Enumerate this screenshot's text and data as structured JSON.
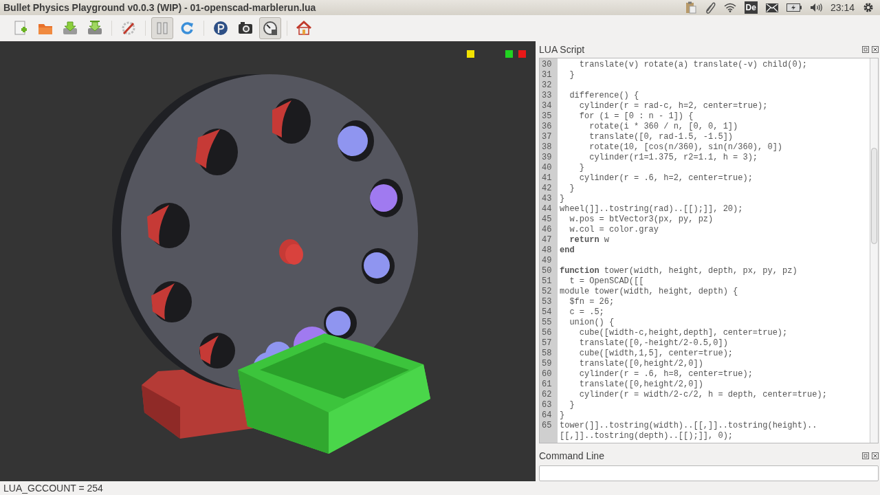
{
  "window": {
    "title": "Bullet Physics Playground v0.0.3 (WIP) - 01-openscad-marblerun.lua"
  },
  "tray": {
    "keyboard": "De",
    "time": "23:14"
  },
  "toolbar": [
    {
      "pressed": false
    },
    {
      "pressed": false
    },
    {
      "pressed": false
    },
    {
      "pressed": false
    },
    {
      "pressed": false
    },
    {
      "pressed": true
    },
    {
      "pressed": false
    },
    {
      "pressed": false
    },
    {
      "pressed": false
    },
    {
      "pressed": true
    },
    {
      "pressed": false
    }
  ],
  "script_panel": {
    "title": "LUA Script",
    "lines": [
      {
        "number": "30",
        "text": "    translate(v) rotate(a) translate(-v) child(0);"
      },
      {
        "number": "31",
        "text": "  }"
      },
      {
        "number": "32"
      },
      {
        "number": "33",
        "text": "  difference() {"
      },
      {
        "number": "34",
        "text": "    cylinder(r = rad-c, h=2, center=true);"
      },
      {
        "number": "35",
        "text": "    for (i = [0 : n - 1]) {"
      },
      {
        "number": "36",
        "text": "      rotate(i * 360 / n, [0, 0, 1])"
      },
      {
        "number": "37",
        "text": "      translate([0, rad-1.5, -1.5])"
      },
      {
        "number": "38",
        "text": "      rotate(10, [cos(n/360), sin(n/360), 0])"
      },
      {
        "number": "39",
        "text": "      cylinder(r1=1.375, r2=1.1, h = 3);"
      },
      {
        "number": "40",
        "text": "    }"
      },
      {
        "number": "41",
        "text": "    cylinder(r = .6, h=2, center=true);"
      },
      {
        "number": "42",
        "text": "  }"
      },
      {
        "number": "43",
        "text": "}"
      },
      {
        "number": "44",
        "text": "wheel(]]..tostring(rad)..[[);]], 20);"
      },
      {
        "number": "45",
        "text": "  w.pos = btVector3(px, py, pz)"
      },
      {
        "number": "46",
        "text": "  w.col = color.gray"
      },
      {
        "number": "47",
        "text": "  **return** w"
      },
      {
        "number": "48",
        "text": "**end**"
      },
      {
        "number": "49"
      },
      {
        "number": "50",
        "text": "**function** tower(width, height, depth, px, py, pz)"
      },
      {
        "number": "51",
        "text": "  t = OpenSCAD([["
      },
      {
        "number": "52",
        "text": "module tower(width, height, depth) {"
      },
      {
        "number": "53",
        "text": "  $fn = 26;"
      },
      {
        "number": "54",
        "text": "  c = .5;"
      },
      {
        "number": "55",
        "text": "  union() {"
      },
      {
        "number": "56",
        "text": "    cube([width-c,height,depth], center=true);"
      },
      {
        "number": "57",
        "text": "    translate([0,-height/2-0.5,0])"
      },
      {
        "number": "58",
        "text": "    cube([width,1,5], center=true);"
      },
      {
        "number": "59",
        "text": "    translate([0,height/2,0])"
      },
      {
        "number": "60",
        "text": "    cylinder(r = .6, h=8, center=true);"
      },
      {
        "number": "61",
        "text": "    translate([0,height/2,0])"
      },
      {
        "number": "62",
        "text": "    cylinder(r = width/2-c/2, h = depth, center=true);"
      },
      {
        "number": "63",
        "text": "  }"
      },
      {
        "number": "64",
        "text": "}"
      },
      {
        "number": "65",
        "text": "tower(]]..tostring(width)..[[,]]..tostring(height).."
      },
      {
        "text": "[[,]]..tostring(depth)..[[);]], 0);"
      }
    ]
  },
  "command_panel": {
    "title": "Command Line"
  },
  "status_bar": "LUA_GCCOUNT = 254"
}
